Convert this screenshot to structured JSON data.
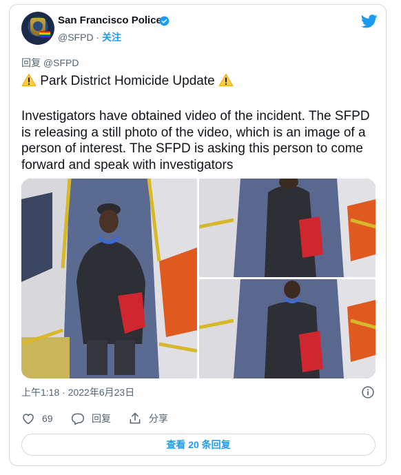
{
  "account": {
    "name": "San Francisco Police",
    "handle": "@SFPD",
    "separator": "·",
    "follow_label": "关注"
  },
  "tweet": {
    "reply_to": "回复 @SFPD",
    "title": "Park District Homicide Update",
    "body": "Investigators have obtained video of the incident. The SFPD is releasing a still photo of the video, which is an image of a person of interest. The SFPD is asking this person to come forward and speak with investigators",
    "timestamp": "上午1:18 · 2022年6月23日"
  },
  "actions": {
    "like_count": "69",
    "reply_label": "回复",
    "share_label": "分享"
  },
  "more_replies_label": "查看 20 条回复",
  "colors": {
    "accent": "#1d9bf0",
    "like": "#f91880",
    "warning": "#ffcc4d",
    "muted": "#536471"
  }
}
